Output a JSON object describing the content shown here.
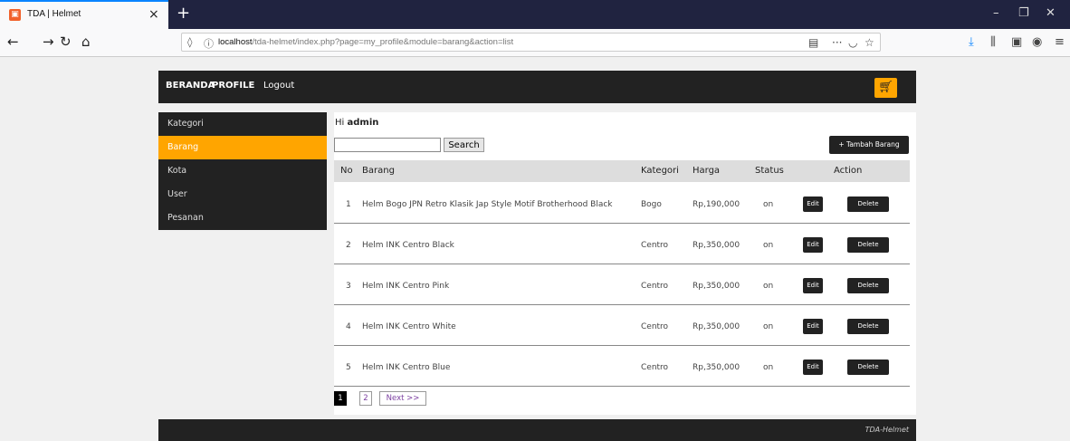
{
  "browser": {
    "tab_title": "TDA | Helmet",
    "tab_favicon": "tda-logo-icon",
    "url_prefix": "localhost",
    "url_path": "/tda-helmet/index.php?page=my_profile&module=barang&action=list"
  },
  "header": {
    "nav": [
      "BERANDA",
      "PROFILE",
      "Logout"
    ],
    "cart_icon": "cart-icon",
    "accent": "#ffa500"
  },
  "sidebar": {
    "items": [
      {
        "label": "Kategori",
        "active": false
      },
      {
        "label": "Barang",
        "active": true
      },
      {
        "label": "Kota",
        "active": false
      },
      {
        "label": "User",
        "active": false
      },
      {
        "label": "Pesanan",
        "active": false
      }
    ]
  },
  "main": {
    "greeting_prefix": "Hi",
    "greeting_user": "admin",
    "search_value": "",
    "search_label": "Search",
    "add_label": "+ Tambah Barang",
    "columns": [
      "No",
      "Barang",
      "Kategori",
      "Harga",
      "Status",
      "Action"
    ],
    "rows": [
      {
        "no": "1",
        "barang": "Helm Bogo JPN Retro Klasik Jap Style Motif Brotherhood Black",
        "kategori": "Bogo",
        "harga": "Rp,190,000",
        "status": "on"
      },
      {
        "no": "2",
        "barang": "Helm INK Centro Black",
        "kategori": "Centro",
        "harga": "Rp,350,000",
        "status": "on"
      },
      {
        "no": "3",
        "barang": "Helm INK Centro Pink",
        "kategori": "Centro",
        "harga": "Rp,350,000",
        "status": "on"
      },
      {
        "no": "4",
        "barang": "Helm INK Centro White",
        "kategori": "Centro",
        "harga": "Rp,350,000",
        "status": "on"
      },
      {
        "no": "5",
        "barang": "Helm INK Centro Blue",
        "kategori": "Centro",
        "harga": "Rp,350,000",
        "status": "on"
      }
    ],
    "edit_label": "Edit",
    "delete_label": "Delete",
    "pagination": {
      "pages": [
        "1",
        "2"
      ],
      "current": "1",
      "next": "Next >>"
    }
  },
  "footer": {
    "text": "TDA-Helmet"
  }
}
